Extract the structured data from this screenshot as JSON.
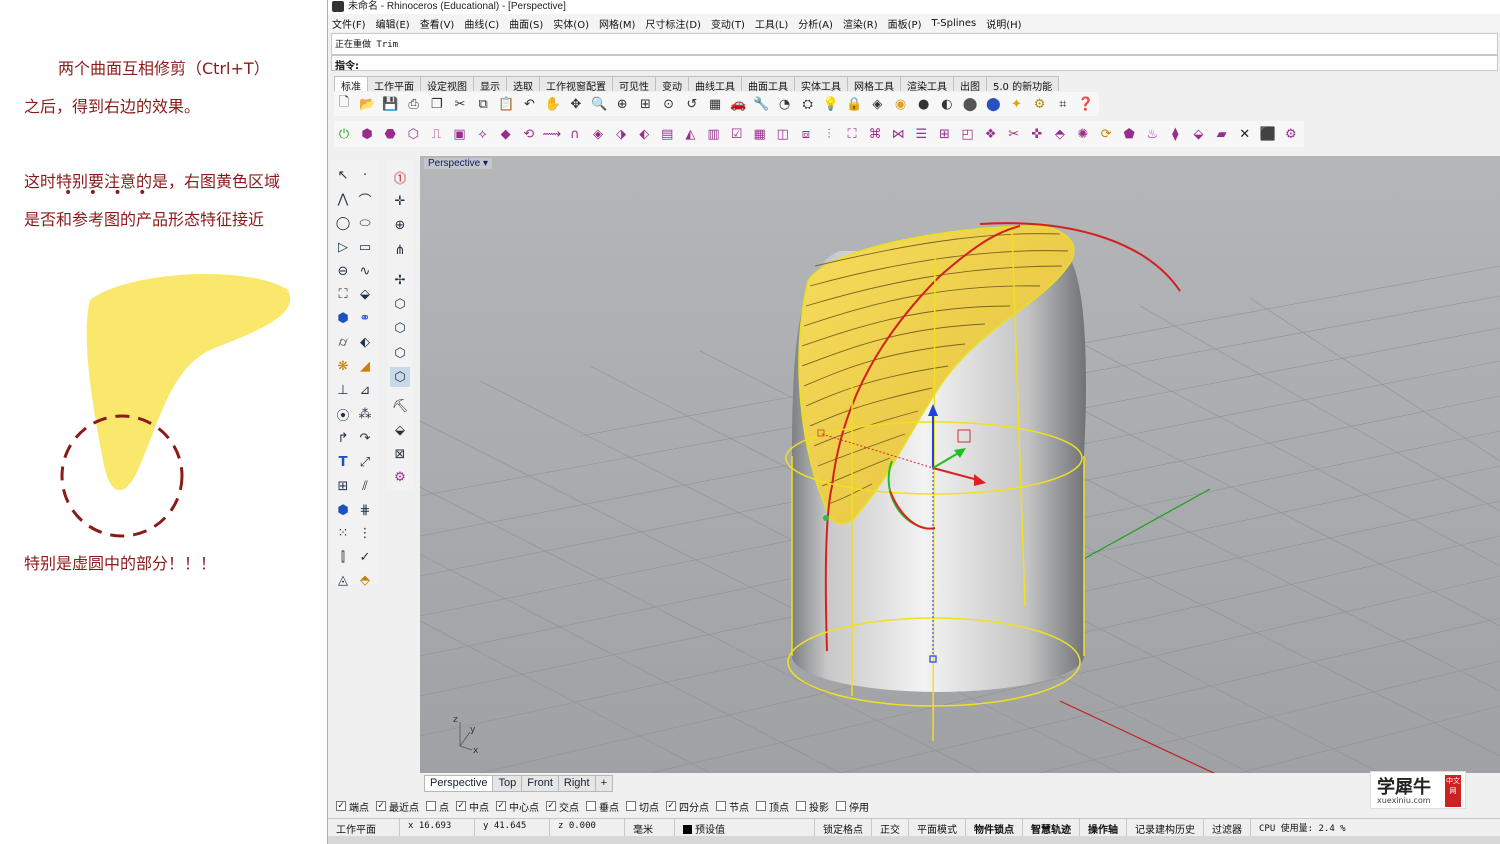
{
  "annotations": {
    "line1": "两个曲面互相修剪（Ctrl+T）",
    "line2": "之后，得到右边的效果。",
    "line3": "这时特别要注意的是，右图黄色区域",
    "line4": "是否和参考图的产品形态特征接近",
    "line5": "特别是虚圆中的部分！！！",
    "emphasis_dots": "• • • •"
  },
  "window": {
    "title": "未命名 - Rhinoceros (Educational) - [Perspective]"
  },
  "menu": [
    "文件(F)",
    "编辑(E)",
    "查看(V)",
    "曲线(C)",
    "曲面(S)",
    "实体(O)",
    "网格(M)",
    "尺寸标注(D)",
    "变动(T)",
    "工具(L)",
    "分析(A)",
    "渲染(R)",
    "面板(P)",
    "T-Splines",
    "说明(H)"
  ],
  "command": {
    "history": "正在重做 Trim",
    "prompt": "指令:"
  },
  "toolbar_tabs": [
    "标准",
    "工作平面",
    "设定视图",
    "显示",
    "选取",
    "工作视窗配置",
    "可见性",
    "变动",
    "曲线工具",
    "曲面工具",
    "实体工具",
    "网格工具",
    "渲染工具",
    "出图",
    "5.0 的新功能"
  ],
  "toolbar_tabs_active": "标准",
  "viewport": {
    "label": "Perspective",
    "dropdown": "▾",
    "axis_z": "z",
    "axis_y": "y",
    "axis_x": "x"
  },
  "viewport_tabs": [
    "Perspective",
    "Top",
    "Front",
    "Right"
  ],
  "viewport_tab_add": "+",
  "osnaps": [
    {
      "label": "端点",
      "checked": true
    },
    {
      "label": "最近点",
      "checked": true
    },
    {
      "label": "点",
      "checked": false
    },
    {
      "label": "中点",
      "checked": true
    },
    {
      "label": "中心点",
      "checked": true
    },
    {
      "label": "交点",
      "checked": true
    },
    {
      "label": "垂点",
      "checked": false
    },
    {
      "label": "切点",
      "checked": false
    },
    {
      "label": "四分点",
      "checked": true
    },
    {
      "label": "节点",
      "checked": false
    },
    {
      "label": "顶点",
      "checked": false
    },
    {
      "label": "投影",
      "checked": false
    },
    {
      "label": "停用",
      "checked": false
    }
  ],
  "status": {
    "cplane": "工作平面",
    "x": "x 16.693",
    "y": "y 41.645",
    "z": "z 0.000",
    "units": "毫米",
    "layer": "预设值",
    "grid_snap": "锁定格点",
    "ortho": "正交",
    "planar": "平面模式",
    "osnap": "物件锁点",
    "smarttrack": "智慧轨迹",
    "gumball": "操作轴",
    "history": "记录建构历史",
    "filter": "过滤器",
    "cpu": "CPU 使用量: 2.4 %"
  },
  "watermark": {
    "name": "学犀牛",
    "url": "xuexiniu.com",
    "badge": "中文网"
  },
  "colors": {
    "annotation_text": "#8b1a1a",
    "yellow_surface": "#f5d94a",
    "viewport_bg": "#a6a8ab",
    "selection_yellow": "#f0e020",
    "curve_red": "#d42020"
  }
}
